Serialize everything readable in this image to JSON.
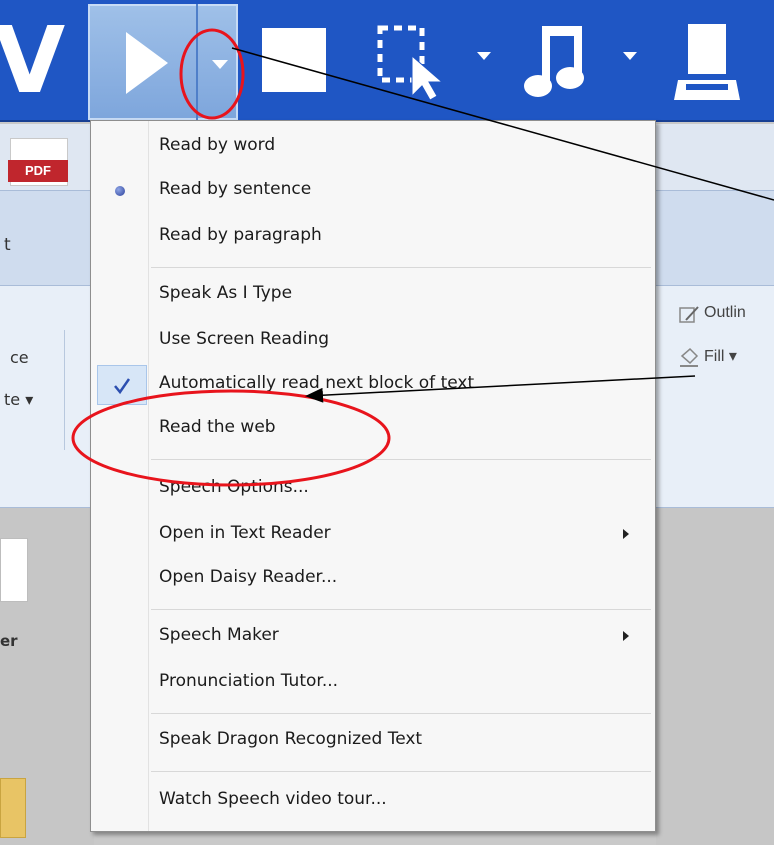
{
  "toolbar": {
    "logo_letter": "V",
    "icons": [
      "play-icon",
      "dropdown-arrow-icon",
      "stop-icon",
      "screen-select-icon",
      "music-note-icon",
      "scanner-icon"
    ]
  },
  "background": {
    "pdf_label": "PDF",
    "ribbon_fragment": "t",
    "left_fragment_1": "ce",
    "left_fragment_2": "te ▾",
    "desk_label": "er",
    "right_fragment_1": "Outlin",
    "right_fragment_2": "Fill ▾"
  },
  "menu": {
    "group1": [
      {
        "label": "Read by word",
        "state": "none"
      },
      {
        "label": "Read by sentence",
        "state": "radio"
      },
      {
        "label": "Read by paragraph",
        "state": "none"
      }
    ],
    "group2": [
      {
        "label": "Speak As I Type",
        "state": "none"
      },
      {
        "label": "Use Screen Reading",
        "state": "none"
      },
      {
        "label": "Automatically read next block of text",
        "state": "checked"
      },
      {
        "label": "Read the web",
        "state": "none"
      }
    ],
    "group3": [
      {
        "label": "Speech Options...",
        "state": "none"
      },
      {
        "label": "Open in Text Reader",
        "state": "submenu"
      },
      {
        "label": "Open Daisy Reader...",
        "state": "none"
      }
    ],
    "group4": [
      {
        "label": "Speech Maker",
        "state": "submenu"
      },
      {
        "label": "Pronunciation Tutor...",
        "state": "none"
      }
    ],
    "group5": [
      {
        "label": "Speak Dragon Recognized Text",
        "state": "none"
      }
    ],
    "group6": [
      {
        "label": "Watch Speech video tour...",
        "state": "none"
      }
    ]
  },
  "colors": {
    "toolbar_blue": "#1f56c4",
    "annotation_red": "#e8141c",
    "check_blue": "#2c4fb0"
  }
}
